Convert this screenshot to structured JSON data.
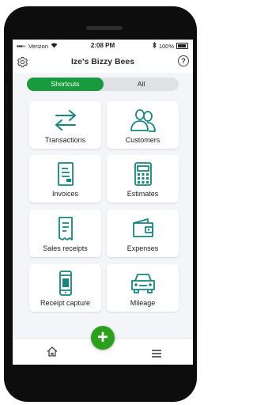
{
  "status_bar": {
    "carrier": "Verizon",
    "time": "2:08 PM",
    "battery": "100%"
  },
  "header": {
    "title": "Ize's Bizzy Bees",
    "help_glyph": "?"
  },
  "tabs": [
    {
      "label": "Shortcuts",
      "selected": true
    },
    {
      "label": "All",
      "selected": false
    }
  ],
  "shortcuts": [
    {
      "label": "Transactions",
      "icon": "transfer-arrows-icon"
    },
    {
      "label": "Customers",
      "icon": "people-icon"
    },
    {
      "label": "Invoices",
      "icon": "invoice-document-icon"
    },
    {
      "label": "Estimates",
      "icon": "calculator-icon"
    },
    {
      "label": "Sales receipts",
      "icon": "receipt-icon"
    },
    {
      "label": "Expenses",
      "icon": "wallet-icon"
    },
    {
      "label": "Receipt capture",
      "icon": "phone-receipt-icon"
    },
    {
      "label": "Mileage",
      "icon": "car-icon"
    }
  ],
  "fab": {
    "glyph": "+"
  },
  "colors": {
    "accent": "#1a9a3e",
    "icon_teal": "#16867f",
    "fab": "#2ca01c"
  }
}
